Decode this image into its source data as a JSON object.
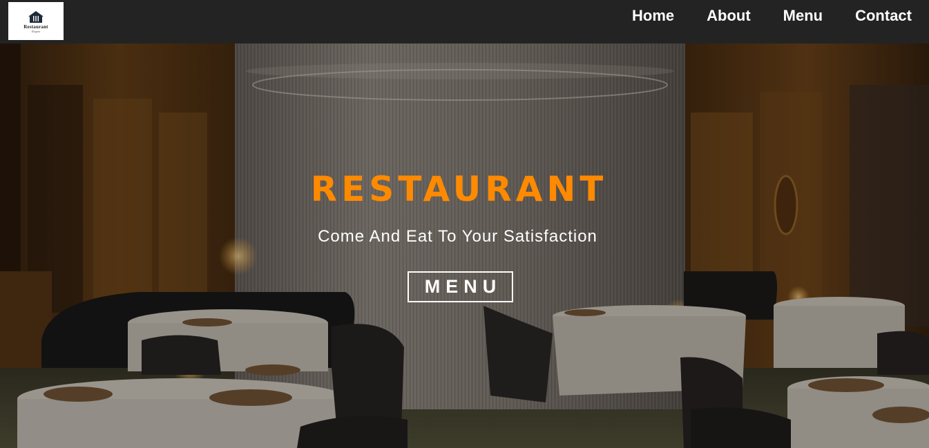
{
  "brand": {
    "logo_text": "Restaurant",
    "logo_tagline": "Elegant"
  },
  "nav": {
    "items": [
      {
        "label": "Home"
      },
      {
        "label": "About"
      },
      {
        "label": "Menu"
      },
      {
        "label": "Contact"
      }
    ]
  },
  "hero": {
    "title": "RESTAURANT",
    "subtitle": "Come And Eat To Your Satisfaction",
    "button_label": "MENU",
    "background": "dining-room-photo"
  },
  "colors": {
    "navbar": "#232323",
    "accent": "#ff8a00",
    "text": "#ffffff"
  }
}
